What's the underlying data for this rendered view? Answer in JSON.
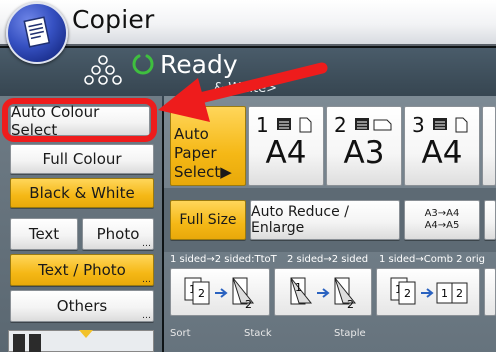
{
  "header": {
    "title": "Copier"
  },
  "status": {
    "text": "Ready",
    "mode_sub": "& White>"
  },
  "left_panel": {
    "auto_colour": "Auto Colour Select",
    "full_colour": "Full Colour",
    "black_white": "Black & White",
    "text": "Text",
    "photo": "Photo",
    "text_photo": "Text / Photo",
    "others": "Others"
  },
  "paper": {
    "auto_line1": "Auto Paper",
    "auto_line2": "Select▶",
    "trays": [
      {
        "num": "1",
        "size": "A4"
      },
      {
        "num": "2",
        "size": "A3"
      },
      {
        "num": "3",
        "size": "A4"
      }
    ]
  },
  "reduce": {
    "full_size": "Full Size",
    "auto_reduce": "Auto Reduce / Enlarge",
    "ratio_line1": "A3→A4",
    "ratio_line2": "A4→A5"
  },
  "duplex": {
    "labels": [
      "1 sided→2 sided:TtoT",
      "2 sided→2 sided",
      "1 sided→Comb 2 orig"
    ]
  },
  "finishing": {
    "sort": "Sort",
    "stack": "Stack",
    "staple": "Staple"
  },
  "colors": {
    "highlight": "#ee1c1c",
    "selected": "#f5b816",
    "ready_green": "#3fbf3f"
  }
}
